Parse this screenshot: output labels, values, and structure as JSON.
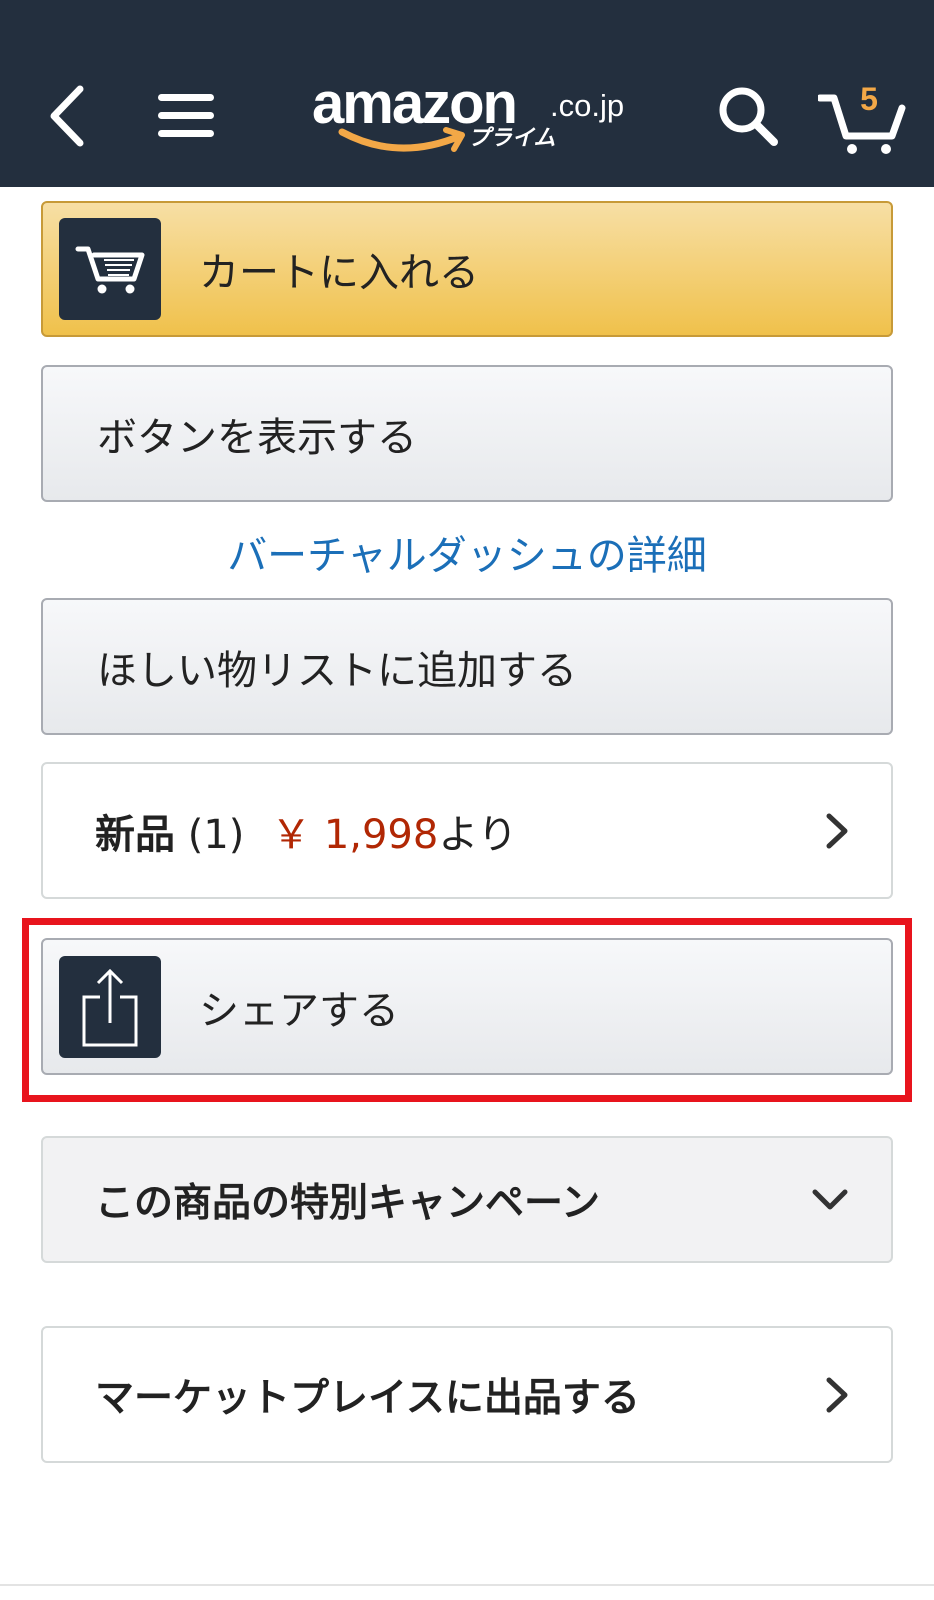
{
  "header": {
    "logo_word": "amazon",
    "logo_tld": ".co.jp",
    "logo_sub": "プライム",
    "cart_count": "5",
    "colors": {
      "background": "#232f3e",
      "accent": "#f3a847"
    },
    "icons": [
      "back-arrow-icon",
      "hamburger-menu-icon",
      "search-icon",
      "cart-icon"
    ]
  },
  "actions": {
    "add_to_cart": "カートに入れる",
    "show_button": "ボタンを表示する",
    "virtual_dash_link": "バーチャルダッシュの詳細",
    "add_to_wishlist": "ほしい物リストに追加する",
    "share": "シェアする"
  },
  "offers": {
    "label": "新品",
    "count": "(1)",
    "price": "￥ 1,998",
    "suffix": "より"
  },
  "campaign": {
    "title": "この商品の特別キャンペーン"
  },
  "marketplace": {
    "title": "マーケットプレイスに出品する"
  },
  "colors": {
    "cart_button": "#f0c14b",
    "price": "#b12704",
    "link": "#1b6fb8",
    "highlight": "#e8141d"
  }
}
